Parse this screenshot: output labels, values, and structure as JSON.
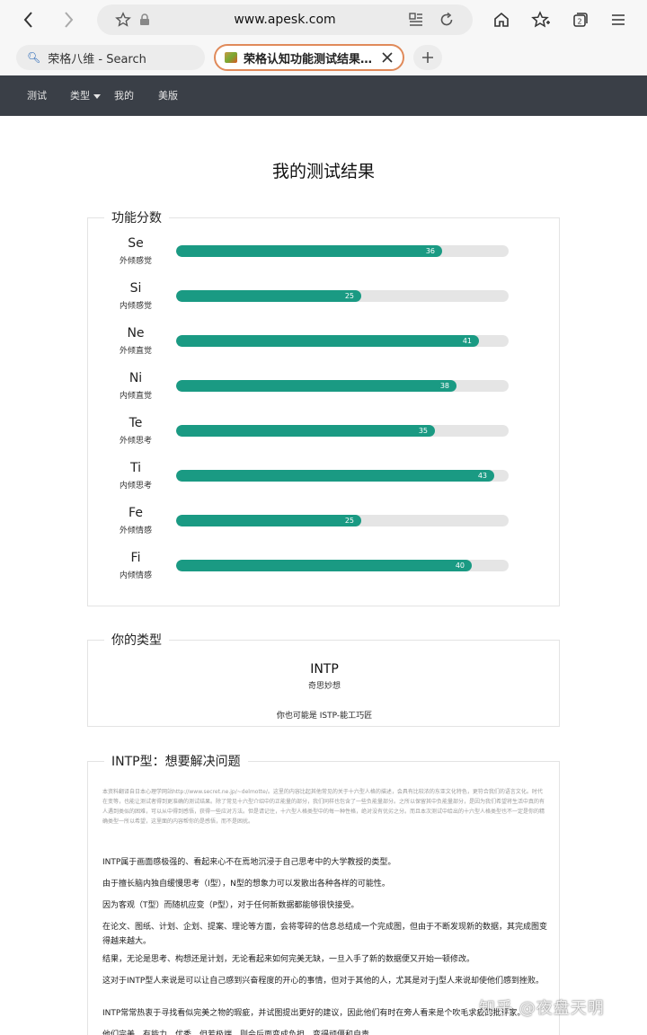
{
  "browser": {
    "url": "www.apesk.com",
    "search_tab_label": "荣格八维 - Search",
    "active_tab_title": "荣格认知功能测试结果：I..."
  },
  "sitenav": {
    "items": [
      "测试",
      "类型",
      "我的",
      "美版"
    ]
  },
  "page": {
    "title": "我的测试结果"
  },
  "functions": {
    "legend": "功能分数",
    "max_value": 45,
    "items": [
      {
        "code": "Se",
        "name": "外倾感觉",
        "value": 36
      },
      {
        "code": "Si",
        "name": "内倾感觉",
        "value": 25
      },
      {
        "code": "Ne",
        "name": "外倾直觉",
        "value": 41
      },
      {
        "code": "Ni",
        "name": "内倾直觉",
        "value": 38
      },
      {
        "code": "Te",
        "name": "外倾思考",
        "value": 35
      },
      {
        "code": "Ti",
        "name": "内倾思考",
        "value": 43
      },
      {
        "code": "Fe",
        "name": "外倾情感",
        "value": 25
      },
      {
        "code": "Fi",
        "name": "内倾情感",
        "value": 40
      }
    ]
  },
  "type_box": {
    "legend": "你的类型",
    "code": "INTP",
    "name": "奇思妙想",
    "alternative": "你也可能是 ISTP-能工巧匠"
  },
  "description": {
    "legend": "INTP型：想要解决问题",
    "note": "本资料翻译自日本心理学网站http://www.secret.ne.jp/~delmotte/。这里的内容比起其他常见的关于十六型人格的描述，会具有比较浓的东亚文化特色，更符合我们的语言文化。时代在变等，也能让测试者得到更准确的测试结果。除了常见十六型介绍中的正能量的部分，我们同样也包含了一些负能量部分。之所以保留其中负能量部分，是因为我们希望将生活中真的有人遇到类似的困难，可以从中得到感悟，获得一些应对方法。但是请记住，十六型人格类型中的每一种性格，绝对没有优劣之分。而且本次测试中给出的十六型人格类型也不一定是你的精确类型一所以希望，这里面的内容帮你的是感悟，而不是困扰。",
    "paragraphs": [
      "INTP属于画面感极强的、看起来心不在焉地沉浸于自己思考中的大学教授的类型。",
      "由于擅长脑内独自缓慢思考（I型），N型的想象力可以发散出各种各样的可能性。",
      "因为客观（T型）而随机应变（P型），对于任何新数据都能够很快接受。",
      "在论文、图纸、计划、企划、提案、理论等方面，会将零碎的信息总结成一个完成图，但由于不断发现新的数据，其完成图变得越来越大。",
      "结果，无论是思考、构想还是计划，无论看起来如何完美无缺，一旦入手了新的数据便又开始一顿修改。",
      "这对于INTP型人来说是可以让自己感到兴奋程度的开心的事情，但对于其他的人，尤其是对于J型人来说却使他们感到挫败。",
      "INTP常常热衷于寻找看似完美之物的瑕疵，并试图提出更好的建议，因此他们有时在旁人看来是个吹毛求疵的批评家。",
      "他们完美、有能力、优秀，但若极端，则会后面变成负担，变得顽僵和自责。"
    ]
  },
  "watermark": "知乎 @夜盘天明"
}
